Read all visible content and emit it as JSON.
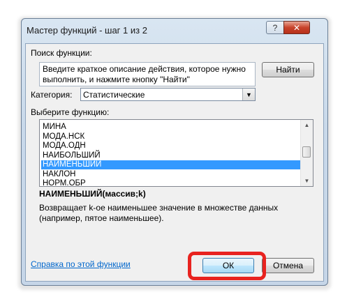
{
  "window": {
    "title": "Мастер функций - шаг 1 из 2",
    "help_glyph": "?",
    "close_glyph": "✕"
  },
  "search": {
    "label": "Поиск функции:",
    "description": "Введите краткое описание действия, которое нужно выполнить, и нажмите кнопку \"Найти\"",
    "find_button": "Найти"
  },
  "category": {
    "label": "Категория:",
    "selected": "Статистические"
  },
  "function_list": {
    "label": "Выберите функцию:",
    "items": [
      "МИНА",
      "МОДА.НСК",
      "МОДА.ОДН",
      "НАИБОЛЬШИЙ",
      "НАИМЕНЬШИЙ",
      "НАКЛОН",
      "НОРМ.ОБР"
    ],
    "selected": "НАИМЕНЬШИЙ"
  },
  "function_info": {
    "signature": "НАИМЕНЬШИЙ(массив;k)",
    "description": "Возвращает k-ое наименьшее значение в множестве данных (например, пятое наименьшее)."
  },
  "footer": {
    "help_link": "Справка по этой функции",
    "ok_button": "ОК",
    "cancel_button": "Отмена"
  },
  "colors": {
    "selection": "#3399ff",
    "highlight": "#e8231f",
    "link": "#0066cc"
  }
}
